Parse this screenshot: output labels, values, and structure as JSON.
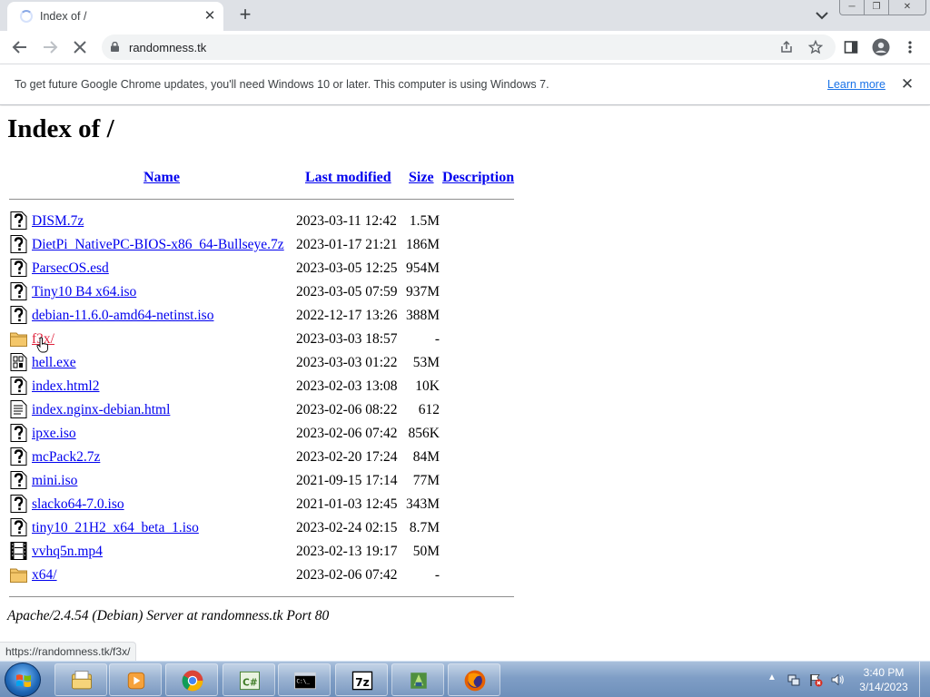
{
  "browser": {
    "tab_title": "Index of /",
    "tab_close_glyph": "✕",
    "new_tab_glyph": "+",
    "url": "randomness.tk",
    "window_buttons": [
      "─",
      "❐",
      "✕"
    ]
  },
  "infobar": {
    "message": "To get future Google Chrome updates, you'll need Windows 10 or later. This computer is using Windows 7.",
    "link_label": "Learn more",
    "close_glyph": "✕"
  },
  "page": {
    "title": "Index of /",
    "columns": {
      "name": "Name",
      "last_modified": "Last modified",
      "size": "Size",
      "description": "Description"
    },
    "files": [
      {
        "name": "DISM.7z",
        "modified": "2023-03-11 12:42",
        "size": "1.5M",
        "icon": "unknown-file-icon"
      },
      {
        "name": "DietPi_NativePC-BIOS-x86_64-Bullseye.7z",
        "modified": "2023-01-17 21:21",
        "size": "186M",
        "icon": "unknown-file-icon"
      },
      {
        "name": "ParsecOS.esd",
        "modified": "2023-03-05 12:25",
        "size": "954M",
        "icon": "unknown-file-icon"
      },
      {
        "name": "Tiny10 B4 x64.iso",
        "modified": "2023-03-05 07:59",
        "size": "937M",
        "icon": "unknown-file-icon"
      },
      {
        "name": "debian-11.6.0-amd64-netinst.iso",
        "modified": "2022-12-17 13:26",
        "size": "388M",
        "icon": "unknown-file-icon"
      },
      {
        "name": "f3x/",
        "modified": "2023-03-03 18:57",
        "size": "-",
        "icon": "folder-icon"
      },
      {
        "name": "hell.exe",
        "modified": "2023-03-03 01:22",
        "size": "53M",
        "icon": "binary-file-icon"
      },
      {
        "name": "index.html2",
        "modified": "2023-02-03 13:08",
        "size": "10K",
        "icon": "unknown-file-icon"
      },
      {
        "name": "index.nginx-debian.html",
        "modified": "2023-02-06 08:22",
        "size": "612",
        "icon": "text-file-icon"
      },
      {
        "name": "ipxe.iso",
        "modified": "2023-02-06 07:42",
        "size": "856K",
        "icon": "unknown-file-icon"
      },
      {
        "name": "mcPack2.7z",
        "modified": "2023-02-20 17:24",
        "size": "84M",
        "icon": "unknown-file-icon"
      },
      {
        "name": "mini.iso",
        "modified": "2021-09-15 17:14",
        "size": "77M",
        "icon": "unknown-file-icon"
      },
      {
        "name": "slacko64-7.0.iso",
        "modified": "2021-01-03 12:45",
        "size": "343M",
        "icon": "unknown-file-icon"
      },
      {
        "name": "tiny10_21H2_x64_beta_1.iso",
        "modified": "2023-02-24 02:15",
        "size": "8.7M",
        "icon": "unknown-file-icon"
      },
      {
        "name": "vvhq5n.mp4",
        "modified": "2023-02-13 19:17",
        "size": "50M",
        "icon": "video-file-icon"
      },
      {
        "name": "x64/",
        "modified": "2023-02-06 07:42",
        "size": "-",
        "icon": "folder-icon"
      }
    ],
    "footer": "Apache/2.4.54 (Debian) Server at randomness.tk Port 80",
    "hovered_link": "f3x/"
  },
  "status_url": "https://randomness.tk/f3x/",
  "taskbar": {
    "apps": [
      {
        "name": "file-explorer-icon"
      },
      {
        "name": "media-player-icon"
      },
      {
        "name": "chrome-icon"
      },
      {
        "name": "csharp-editor-icon"
      },
      {
        "name": "command-prompt-icon"
      },
      {
        "name": "7zip-icon"
      },
      {
        "name": "network-tool-icon"
      },
      {
        "name": "firefox-icon"
      }
    ],
    "time": "3:40 PM",
    "date": "3/14/2023"
  },
  "colors": {
    "link": "#0000ee",
    "chrome_tabstrip": "#dee1e6",
    "chrome_link": "#1a73e8",
    "hover_link": "#e0213b"
  }
}
